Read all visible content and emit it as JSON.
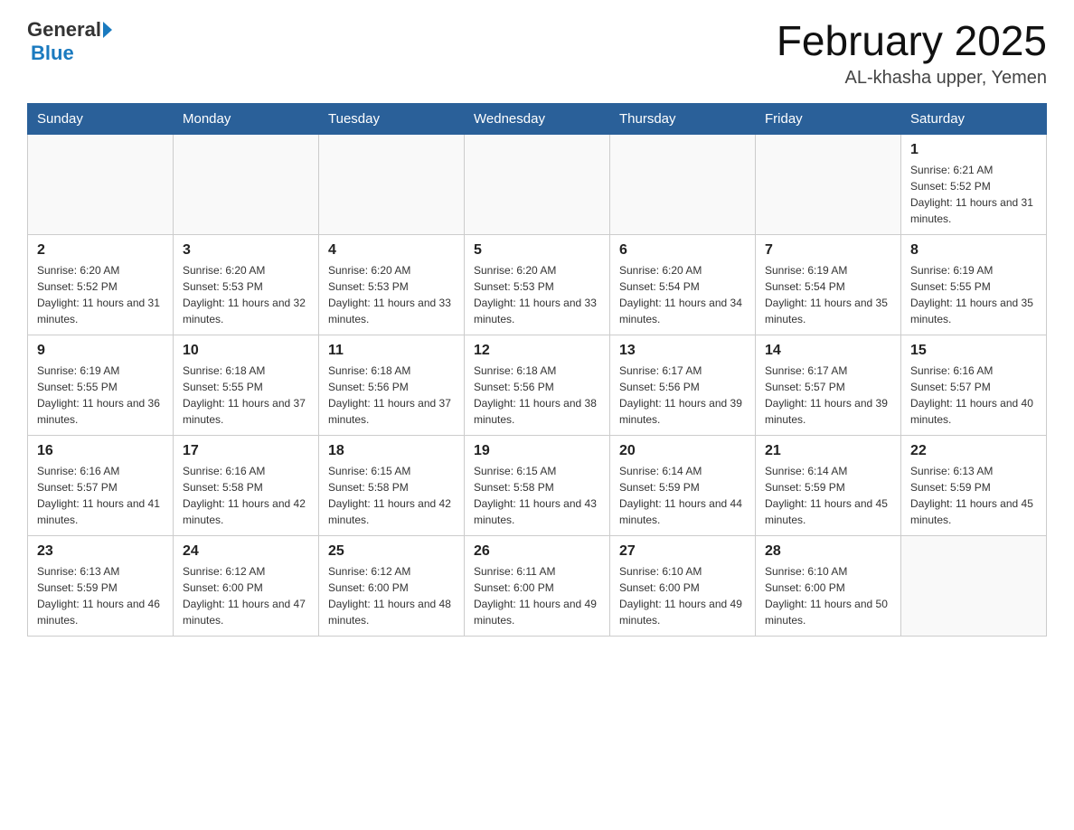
{
  "header": {
    "logo_general": "General",
    "logo_blue": "Blue",
    "title": "February 2025",
    "subtitle": "AL-khasha upper, Yemen"
  },
  "weekdays": [
    "Sunday",
    "Monday",
    "Tuesday",
    "Wednesday",
    "Thursday",
    "Friday",
    "Saturday"
  ],
  "weeks": [
    [
      {
        "day": "",
        "info": ""
      },
      {
        "day": "",
        "info": ""
      },
      {
        "day": "",
        "info": ""
      },
      {
        "day": "",
        "info": ""
      },
      {
        "day": "",
        "info": ""
      },
      {
        "day": "",
        "info": ""
      },
      {
        "day": "1",
        "info": "Sunrise: 6:21 AM\nSunset: 5:52 PM\nDaylight: 11 hours and 31 minutes."
      }
    ],
    [
      {
        "day": "2",
        "info": "Sunrise: 6:20 AM\nSunset: 5:52 PM\nDaylight: 11 hours and 31 minutes."
      },
      {
        "day": "3",
        "info": "Sunrise: 6:20 AM\nSunset: 5:53 PM\nDaylight: 11 hours and 32 minutes."
      },
      {
        "day": "4",
        "info": "Sunrise: 6:20 AM\nSunset: 5:53 PM\nDaylight: 11 hours and 33 minutes."
      },
      {
        "day": "5",
        "info": "Sunrise: 6:20 AM\nSunset: 5:53 PM\nDaylight: 11 hours and 33 minutes."
      },
      {
        "day": "6",
        "info": "Sunrise: 6:20 AM\nSunset: 5:54 PM\nDaylight: 11 hours and 34 minutes."
      },
      {
        "day": "7",
        "info": "Sunrise: 6:19 AM\nSunset: 5:54 PM\nDaylight: 11 hours and 35 minutes."
      },
      {
        "day": "8",
        "info": "Sunrise: 6:19 AM\nSunset: 5:55 PM\nDaylight: 11 hours and 35 minutes."
      }
    ],
    [
      {
        "day": "9",
        "info": "Sunrise: 6:19 AM\nSunset: 5:55 PM\nDaylight: 11 hours and 36 minutes."
      },
      {
        "day": "10",
        "info": "Sunrise: 6:18 AM\nSunset: 5:55 PM\nDaylight: 11 hours and 37 minutes."
      },
      {
        "day": "11",
        "info": "Sunrise: 6:18 AM\nSunset: 5:56 PM\nDaylight: 11 hours and 37 minutes."
      },
      {
        "day": "12",
        "info": "Sunrise: 6:18 AM\nSunset: 5:56 PM\nDaylight: 11 hours and 38 minutes."
      },
      {
        "day": "13",
        "info": "Sunrise: 6:17 AM\nSunset: 5:56 PM\nDaylight: 11 hours and 39 minutes."
      },
      {
        "day": "14",
        "info": "Sunrise: 6:17 AM\nSunset: 5:57 PM\nDaylight: 11 hours and 39 minutes."
      },
      {
        "day": "15",
        "info": "Sunrise: 6:16 AM\nSunset: 5:57 PM\nDaylight: 11 hours and 40 minutes."
      }
    ],
    [
      {
        "day": "16",
        "info": "Sunrise: 6:16 AM\nSunset: 5:57 PM\nDaylight: 11 hours and 41 minutes."
      },
      {
        "day": "17",
        "info": "Sunrise: 6:16 AM\nSunset: 5:58 PM\nDaylight: 11 hours and 42 minutes."
      },
      {
        "day": "18",
        "info": "Sunrise: 6:15 AM\nSunset: 5:58 PM\nDaylight: 11 hours and 42 minutes."
      },
      {
        "day": "19",
        "info": "Sunrise: 6:15 AM\nSunset: 5:58 PM\nDaylight: 11 hours and 43 minutes."
      },
      {
        "day": "20",
        "info": "Sunrise: 6:14 AM\nSunset: 5:59 PM\nDaylight: 11 hours and 44 minutes."
      },
      {
        "day": "21",
        "info": "Sunrise: 6:14 AM\nSunset: 5:59 PM\nDaylight: 11 hours and 45 minutes."
      },
      {
        "day": "22",
        "info": "Sunrise: 6:13 AM\nSunset: 5:59 PM\nDaylight: 11 hours and 45 minutes."
      }
    ],
    [
      {
        "day": "23",
        "info": "Sunrise: 6:13 AM\nSunset: 5:59 PM\nDaylight: 11 hours and 46 minutes."
      },
      {
        "day": "24",
        "info": "Sunrise: 6:12 AM\nSunset: 6:00 PM\nDaylight: 11 hours and 47 minutes."
      },
      {
        "day": "25",
        "info": "Sunrise: 6:12 AM\nSunset: 6:00 PM\nDaylight: 11 hours and 48 minutes."
      },
      {
        "day": "26",
        "info": "Sunrise: 6:11 AM\nSunset: 6:00 PM\nDaylight: 11 hours and 49 minutes."
      },
      {
        "day": "27",
        "info": "Sunrise: 6:10 AM\nSunset: 6:00 PM\nDaylight: 11 hours and 49 minutes."
      },
      {
        "day": "28",
        "info": "Sunrise: 6:10 AM\nSunset: 6:00 PM\nDaylight: 11 hours and 50 minutes."
      },
      {
        "day": "",
        "info": ""
      }
    ]
  ]
}
